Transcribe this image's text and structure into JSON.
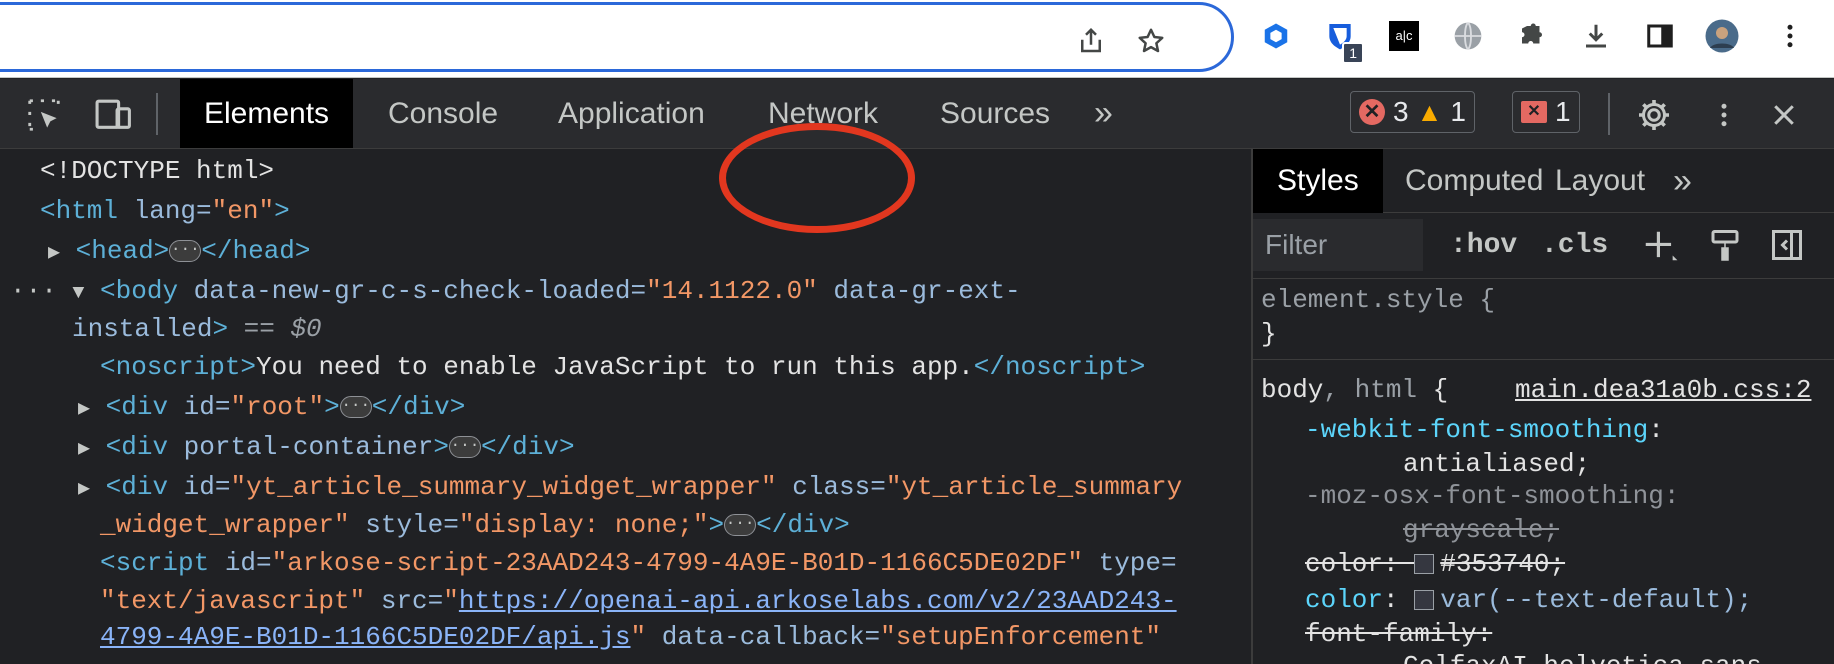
{
  "extensions": [
    {
      "name": "extension-blue-hexagon-icon"
    },
    {
      "name": "password-manager-extension-icon",
      "badge": "1"
    },
    {
      "name": "ac-extension-icon",
      "label": "a|c"
    },
    {
      "name": "globe-extension-icon"
    },
    {
      "name": "extensions-puzzle-icon"
    },
    {
      "name": "downloads-icon"
    },
    {
      "name": "side-panel-icon"
    },
    {
      "name": "profile-avatar"
    },
    {
      "name": "chrome-menu-icon"
    }
  ],
  "devtools": {
    "tabs": [
      "Elements",
      "Console",
      "Application",
      "Network",
      "Sources"
    ],
    "more_tabs": "»",
    "active_tab": "Elements",
    "errors": "3",
    "warnings": "1",
    "issues": "1"
  },
  "dom": {
    "doctype": "<!DOCTYPE html>",
    "html_open": "<html",
    "lang_attr": " lang=",
    "lang_val": "\"en\"",
    "head_open": "<head>",
    "head_close": "</head>",
    "body_open": "<body",
    "body_attr1": " data-new-gr-c-s-check-loaded=",
    "body_val1": "\"14.1122.0\"",
    "body_attr2": " data-gr-ext-",
    "body_attr2b": "installed",
    "dollar0": " == $0",
    "noscript_open": "<noscript>",
    "noscript_text": "You need to enable JavaScript to run this app.",
    "noscript_close": "</noscript>",
    "div_open": "<div",
    "div_close": "</div>",
    "id_attr": " id=",
    "root_val": "\"root\"",
    "portal_attr": " portal-container",
    "yt_id_val": "\"yt_article_summary_widget_wrapper\"",
    "class_attr": " class=",
    "yt_class_val1": "\"yt_article_summary",
    "yt_class_val2": "_widget_wrapper\"",
    "style_attr": " style=",
    "style_val": "\"display: none;\"",
    "script_open": "<script",
    "script_id_val": "\"arkose-script-23AAD243-4799-4A9E-B01D-1166C5DE02DF\"",
    "type_attr": " type=",
    "type_val": "\"text/javascript\"",
    "src_attr": " src=",
    "src_url1": "https://openai-api.arkoselabs.com/v2/23AAD243-",
    "src_url2": "4799-4A9E-B01D-1166C5DE02DF/api.js",
    "callback_attr": " data-callback=",
    "callback_val": "\"setupEnforcement\""
  },
  "styles": {
    "tabs": [
      "Styles",
      "Computed",
      "Layout"
    ],
    "more_tabs": "»",
    "filter_placeholder": "Filter",
    "hov": ":hov",
    "cls": ".cls",
    "element_style": "element.style {",
    "close_brace": "}",
    "selector_body": "body",
    "selector_html": ", html",
    "selector_open": " {",
    "source_link": "main.dea31a0b.css:2",
    "rules": [
      {
        "prop": "-webkit-font-smoothing",
        "value": ""
      },
      {
        "prop": "",
        "value": "antialiased;"
      },
      {
        "prop": "-moz-osx-font-smoothing",
        "value": ""
      },
      {
        "prop": "",
        "value": "grayscale;"
      },
      {
        "prop": "color",
        "value": "#353740;"
      },
      {
        "prop": "color",
        "value": "var(--text-default);"
      },
      {
        "prop": "font-family",
        "value": ""
      },
      {
        "prop": "",
        "value": "ColfaxAI,helvetica,sans-"
      }
    ]
  },
  "colors": {
    "omnibox_focus": "#2b68d9",
    "annotation": "#e2371f",
    "error": "#e46962",
    "warning": "#f9ab00"
  }
}
